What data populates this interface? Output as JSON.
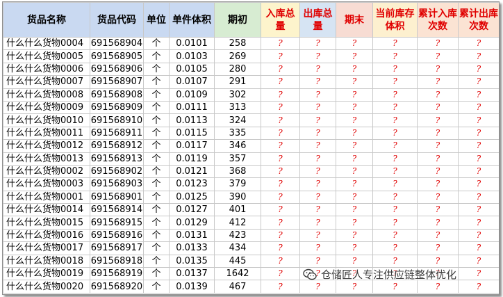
{
  "header": {
    "name": "货品名称",
    "code": "货品代码",
    "unit": "单位",
    "unit_volume": "单件体积",
    "opening": "期初",
    "inbound_total": "入库总量",
    "outbound_total": "出库总量",
    "closing": "期末",
    "current_volume": "当前库存体积",
    "inbound_count": "累计入库次数",
    "outbound_count": "累计出库次数"
  },
  "colors": {
    "header_blue": "#c9d9f1",
    "header_green": "#d7ecd2",
    "header_red_text": "#e00000"
  },
  "placeholder": "?",
  "rows": [
    {
      "name": "什么什么货物0004",
      "code": "691568904",
      "unit": "个",
      "volume": "0.0101",
      "opening": "258"
    },
    {
      "name": "什么什么货物0005",
      "code": "691568905",
      "unit": "个",
      "volume": "0.0103",
      "opening": "269"
    },
    {
      "name": "什么什么货物0006",
      "code": "691568906",
      "unit": "个",
      "volume": "0.0105",
      "opening": "280"
    },
    {
      "name": "什么什么货物0007",
      "code": "691568907",
      "unit": "个",
      "volume": "0.0107",
      "opening": "291"
    },
    {
      "name": "什么什么货物0008",
      "code": "691568908",
      "unit": "个",
      "volume": "0.0109",
      "opening": "302"
    },
    {
      "name": "什么什么货物0009",
      "code": "691568909",
      "unit": "个",
      "volume": "0.0111",
      "opening": "313"
    },
    {
      "name": "什么什么货物0010",
      "code": "691568910",
      "unit": "个",
      "volume": "0.0113",
      "opening": "324"
    },
    {
      "name": "什么什么货物0011",
      "code": "691568911",
      "unit": "个",
      "volume": "0.0115",
      "opening": "335"
    },
    {
      "name": "什么什么货物0012",
      "code": "691568912",
      "unit": "个",
      "volume": "0.0117",
      "opening": "346"
    },
    {
      "name": "什么什么货物0013",
      "code": "691568913",
      "unit": "个",
      "volume": "0.0119",
      "opening": "357"
    },
    {
      "name": "什么什么货物0002",
      "code": "691568902",
      "unit": "个",
      "volume": "0.0121",
      "opening": "368"
    },
    {
      "name": "什么什么货物0003",
      "code": "691568903",
      "unit": "个",
      "volume": "0.0123",
      "opening": "379"
    },
    {
      "name": "什么什么货物0001",
      "code": "691568901",
      "unit": "个",
      "volume": "0.0125",
      "opening": "390"
    },
    {
      "name": "什么什么货物0014",
      "code": "691568914",
      "unit": "个",
      "volume": "0.0127",
      "opening": "401"
    },
    {
      "name": "什么什么货物0015",
      "code": "691568915",
      "unit": "个",
      "volume": "0.0129",
      "opening": "412"
    },
    {
      "name": "什么什么货物0016",
      "code": "691568916",
      "unit": "个",
      "volume": "0.0131",
      "opening": "423"
    },
    {
      "name": "什么什么货物0017",
      "code": "691568917",
      "unit": "个",
      "volume": "0.0133",
      "opening": "434"
    },
    {
      "name": "什么什么货物0018",
      "code": "691568918",
      "unit": "个",
      "volume": "0.0135",
      "opening": "445"
    },
    {
      "name": "什么什么货物0019",
      "code": "691568919",
      "unit": "个",
      "volume": "0.0137",
      "opening": "1642"
    },
    {
      "name": "什么什么货物0020",
      "code": "691568920",
      "unit": "个",
      "volume": "0.0139",
      "opening": "467"
    }
  ],
  "watermark": {
    "icon": "wechat-icon",
    "text": "仓储匠人专注供应链整体优化"
  }
}
